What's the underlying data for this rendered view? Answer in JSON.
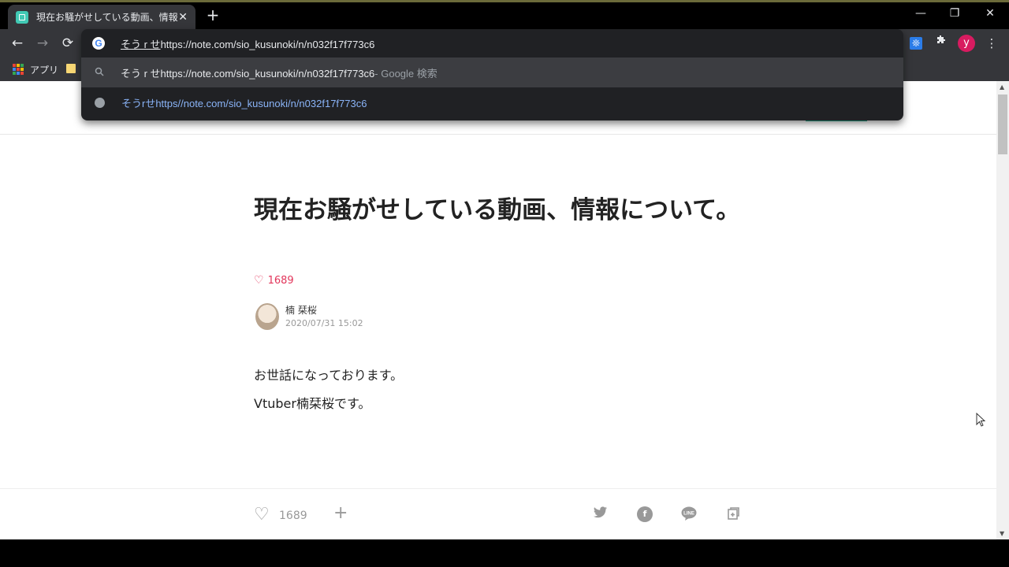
{
  "browser": {
    "tab": {
      "title": "現在お騒がせしている動画、情報について",
      "close": "✕",
      "favicon": "note-favicon"
    },
    "new_tab": "+",
    "window_controls": {
      "minimize": "—",
      "restore": "❐",
      "close": "✕"
    },
    "nav": {
      "back": "←",
      "forward": "→",
      "reload": "⟳"
    },
    "extensions": {
      "puzzle": "puzzle-icon",
      "snowflake": "❊",
      "menu": "⋮"
    },
    "profile_initial": "y",
    "bookmarks": {
      "apps_label": "アプリ"
    }
  },
  "omnibox": {
    "typed_prefix": "そう r せ",
    "typed_url": "https://note.com/sio_kusunoki/n/n032f17f773c6",
    "g_letter": "G",
    "suggestions": [
      {
        "icon": "search-icon",
        "main": "そう r せhttps://note.com/sio_kusunoki/n/n032f17f773c6",
        "desc": " - Google 検索"
      },
      {
        "icon": "globe-icon",
        "link": "そうrせhttps//note.com/sio_kusunoki/n/n032f17f773c6"
      }
    ]
  },
  "article": {
    "title": "現在お騒がせしている動画、情報について。",
    "likes": "1689",
    "author": {
      "name": "楠 栞桜",
      "date": "2020/07/31 15:02"
    },
    "paragraphs": [
      "お世話になっております。",
      "Vtuber楠栞桜です。"
    ]
  },
  "footer": {
    "likes": "1689",
    "plus": "+"
  },
  "colors": {
    "accent": "#2cb696",
    "like": "#e2365b",
    "chrome_dark": "#35363a",
    "omnibox_bg": "#202124",
    "link": "#8ab4f8"
  }
}
